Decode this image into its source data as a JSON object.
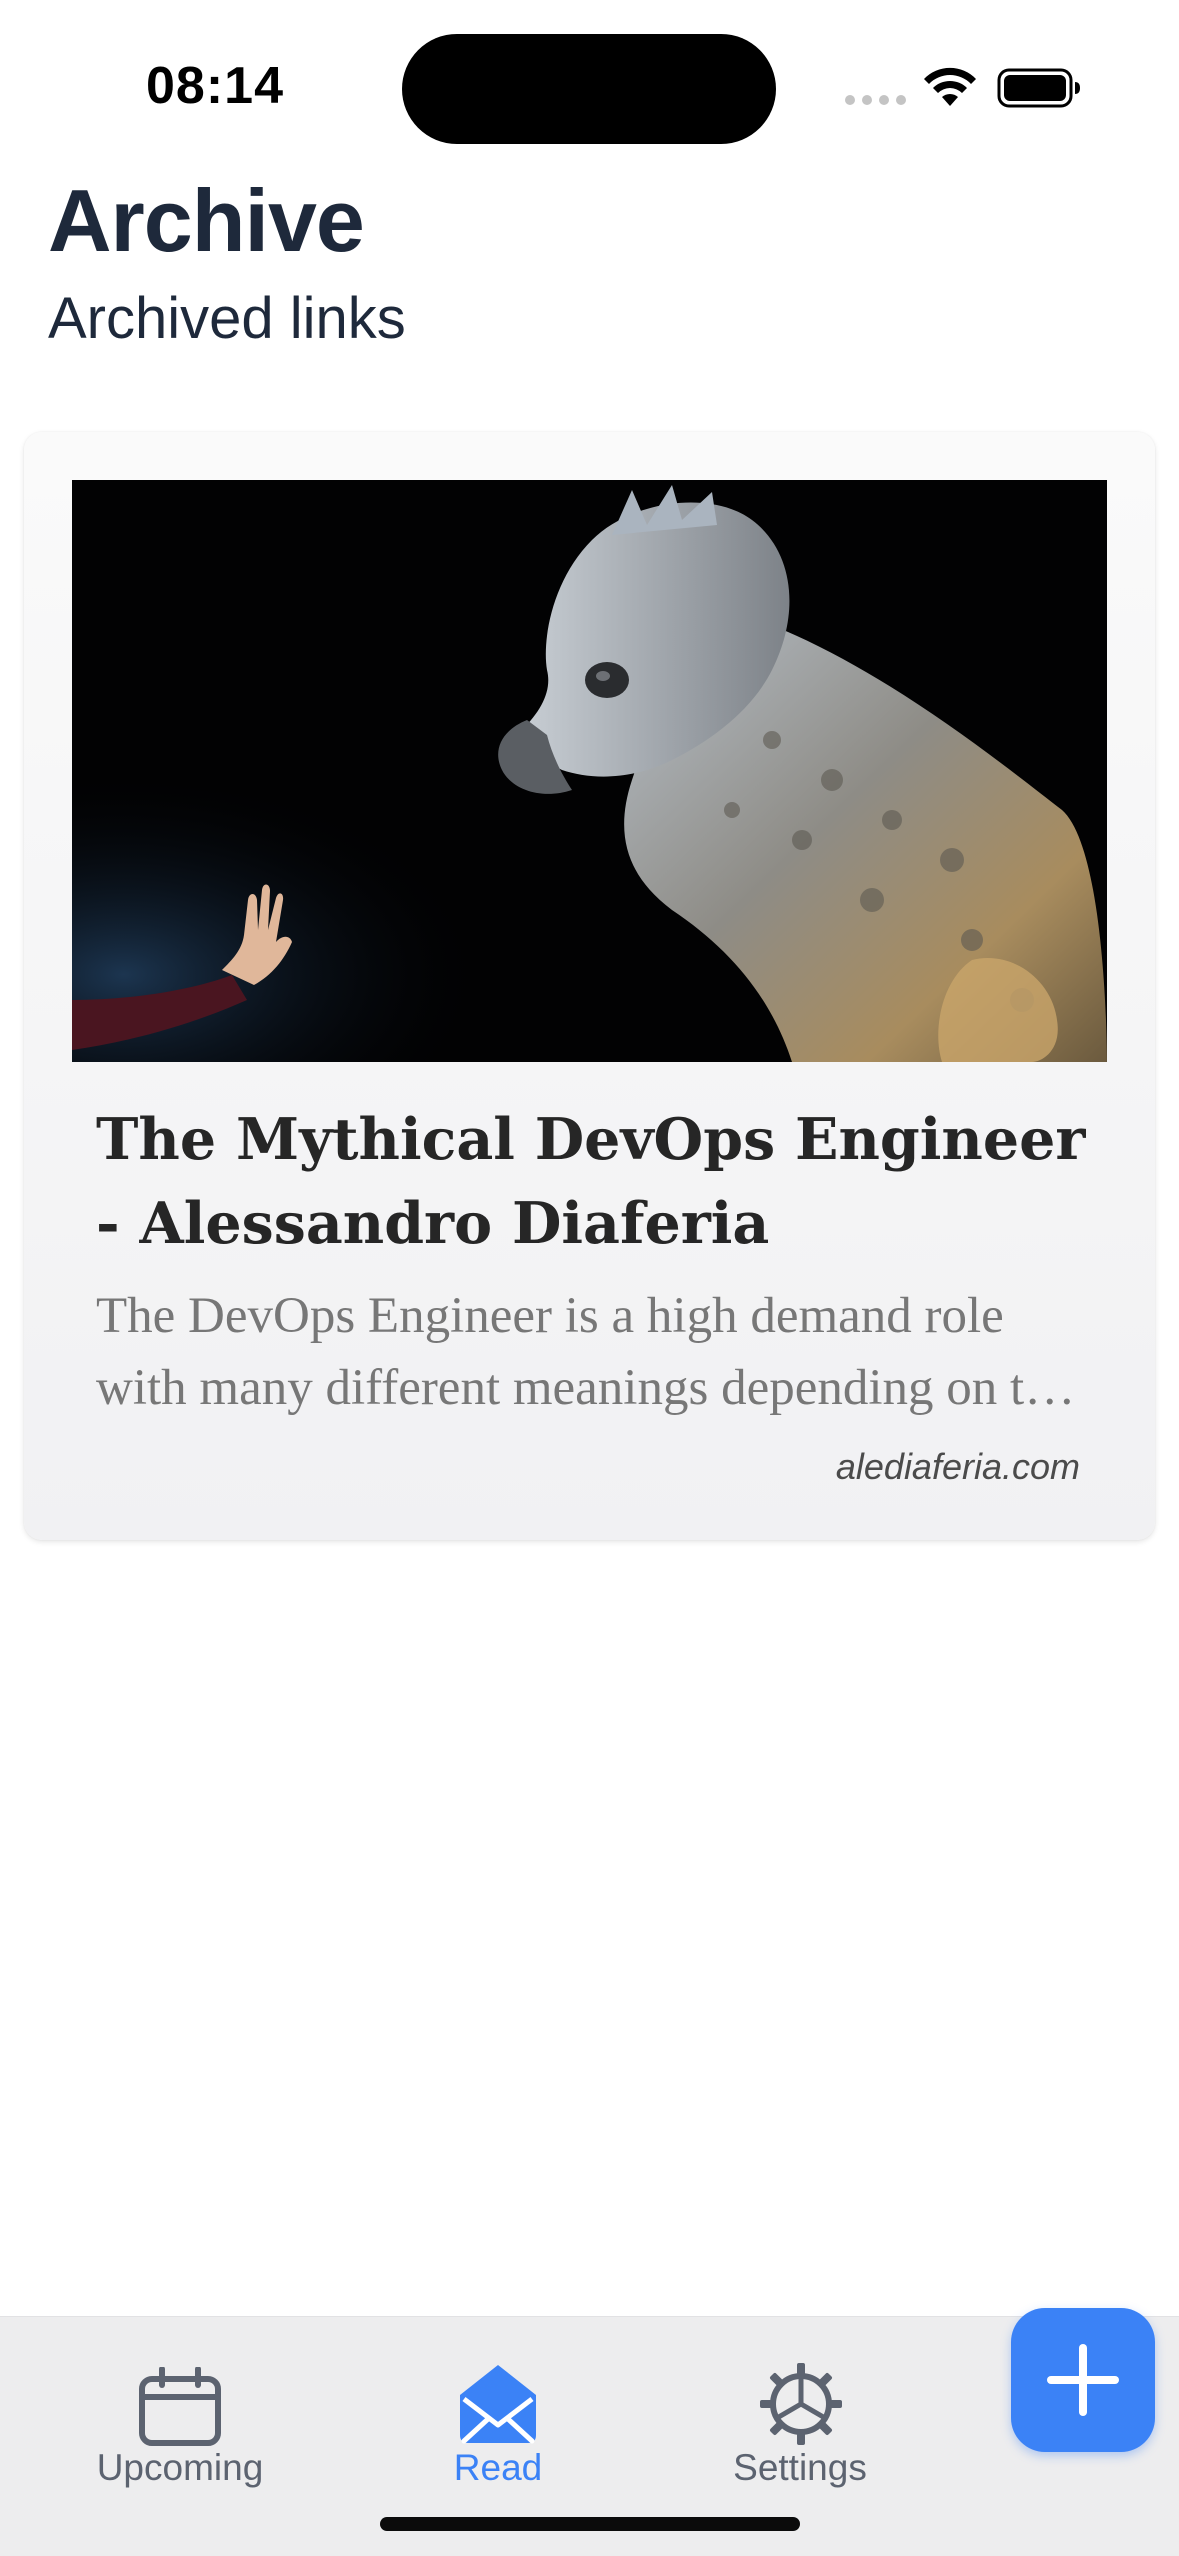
{
  "status_bar": {
    "time": "08:14"
  },
  "header": {
    "title": "Archive",
    "subtitle": "Archived links"
  },
  "cards": [
    {
      "title": "The Mythical DevOps Engineer - Alessandro Diaferia",
      "description": "The DevOps Engineer is a high demand role with many different meanings depending on the company and the context.",
      "domain": "alediaferia.com",
      "image_alt": "Hippogriff creature with outstretched hand"
    }
  ],
  "tab_bar": {
    "tabs": [
      {
        "label": "Upcoming",
        "icon": "calendar-icon",
        "active": false
      },
      {
        "label": "Read",
        "icon": "envelope-open-icon",
        "active": true
      },
      {
        "label": "Settings",
        "icon": "gear-icon",
        "active": false
      }
    ],
    "add_button_icon": "plus-icon"
  },
  "colors": {
    "accent": "#3b82f6",
    "title": "#1e293b",
    "tab_inactive": "#5c6370",
    "tab_bar_bg": "#ededee"
  }
}
